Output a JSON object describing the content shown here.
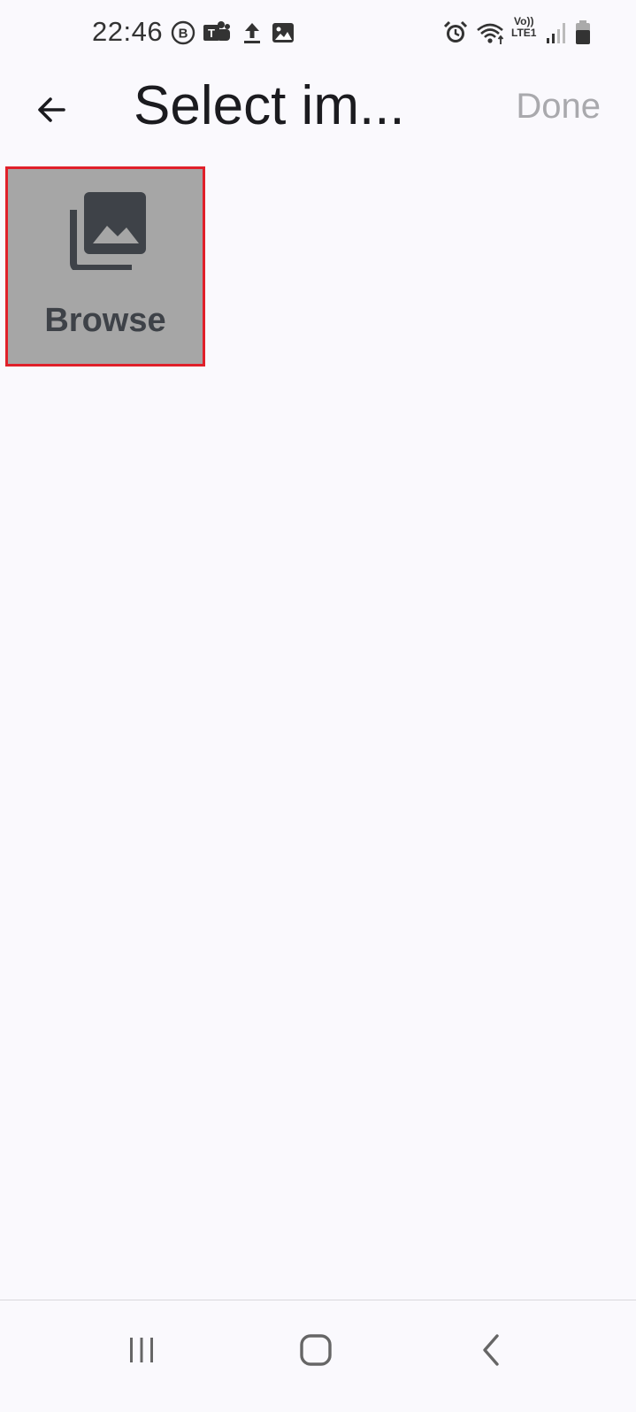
{
  "status_bar": {
    "time": "22:46",
    "left_icons": [
      "b-circle-icon",
      "teams-icon",
      "upload-icon",
      "image-icon"
    ],
    "right_icons": [
      "alarm-icon",
      "wifi-icon",
      "volte-lte1-icon",
      "signal-icon",
      "battery-icon"
    ],
    "volte_label": "Vo))",
    "lte_label": "LTE1"
  },
  "app_bar": {
    "title": "Select im...",
    "done_label": "Done"
  },
  "browse_tile": {
    "label": "Browse",
    "icon": "photo-library-icon"
  },
  "colors": {
    "background": "#faf9fd",
    "tile_background": "#a6a6a6",
    "highlight_border": "#e0202a",
    "done_disabled": "#a9a9ad"
  },
  "nav_bar": {
    "items": [
      "recents-icon",
      "home-icon",
      "back-icon"
    ]
  }
}
